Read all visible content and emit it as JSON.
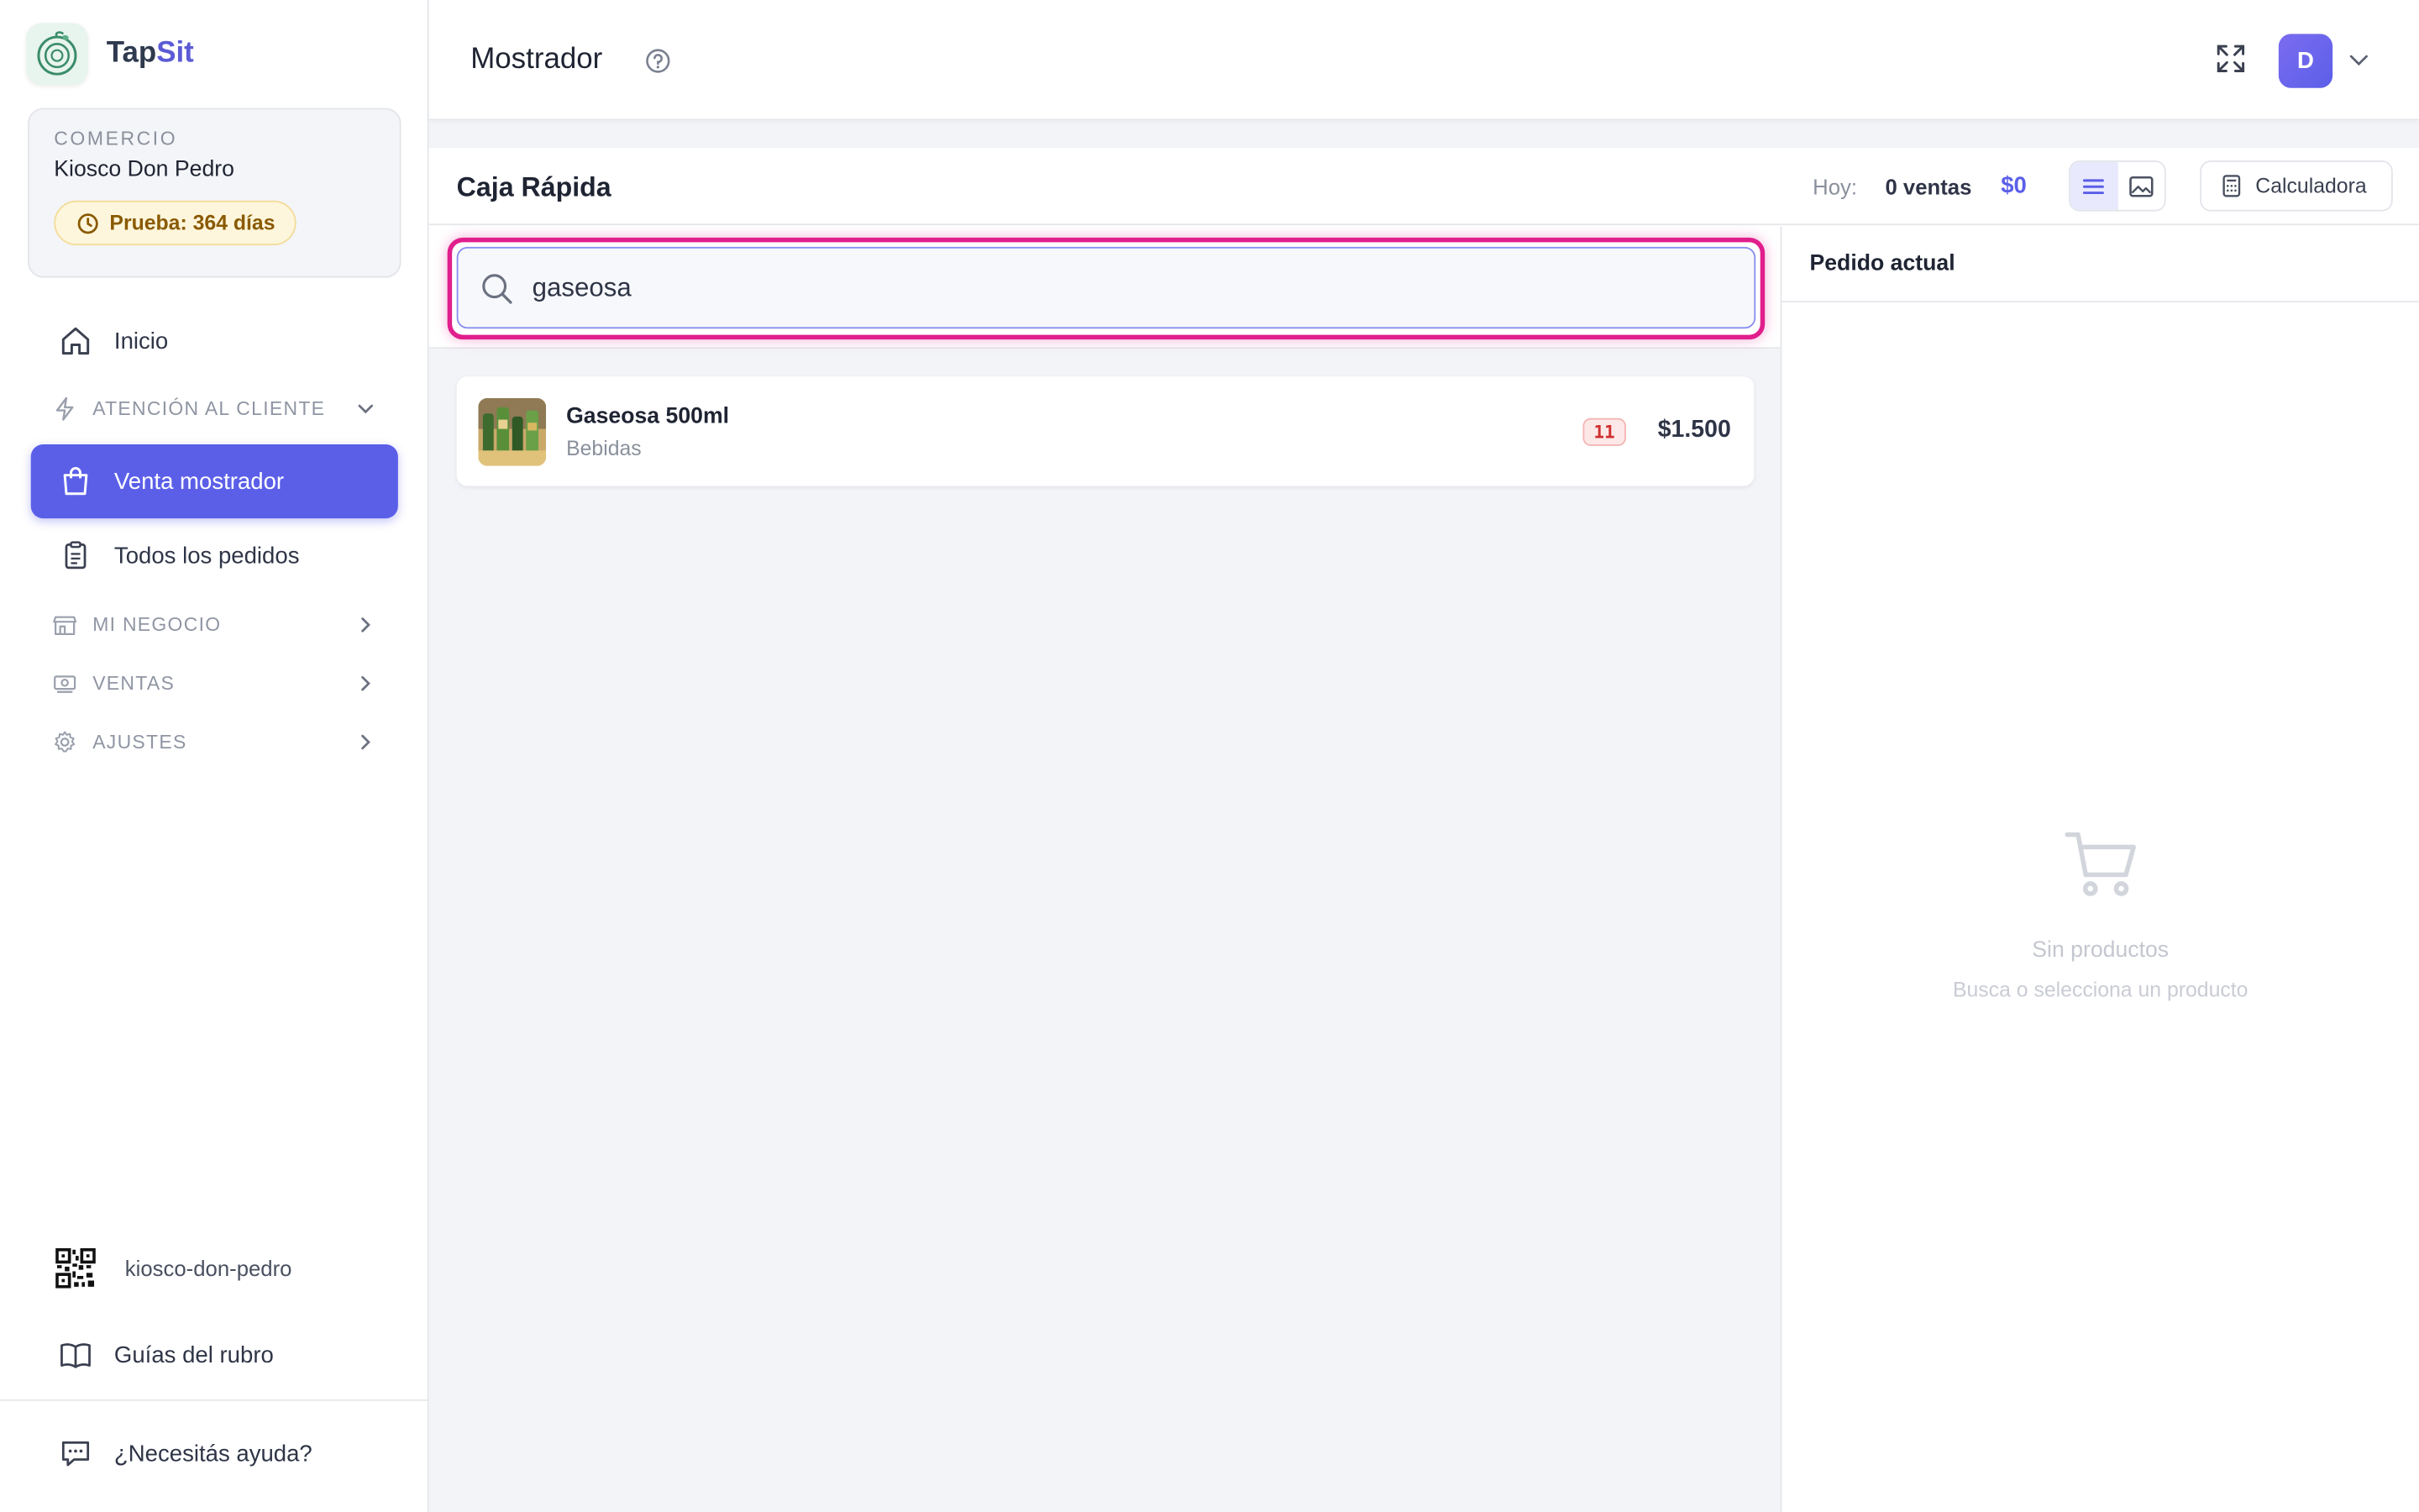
{
  "brand": {
    "name_part1": "Tap",
    "name_part2": "Sit"
  },
  "store": {
    "caption": "COMERCIO",
    "name": "Kiosco Don Pedro",
    "trial": "Prueba: 364 días"
  },
  "nav": {
    "inicio": "Inicio",
    "atencion": "ATENCIÓN AL CLIENTE",
    "venta_mostrador": "Venta mostrador",
    "todos_pedidos": "Todos los pedidos",
    "mi_negocio": "MI NEGOCIO",
    "ventas": "VENTAS",
    "ajustes": "AJUSTES"
  },
  "bottom": {
    "qr_slug": "kiosco-don-pedro",
    "guides": "Guías del rubro",
    "help": "¿Necesitás ayuda?"
  },
  "topbar": {
    "title": "Mostrador",
    "avatar_initial": "D"
  },
  "pos": {
    "title": "Caja Rápida",
    "today_label": "Hoy:",
    "today_count": "0 ventas",
    "today_total": "$0",
    "calculator": "Calculadora"
  },
  "search": {
    "value": "gaseosa"
  },
  "results": [
    {
      "name": "Gaseosa 500ml",
      "category": "Bebidas",
      "stock": "11",
      "price": "$1.500"
    }
  ],
  "order": {
    "title": "Pedido actual",
    "empty_title": "Sin productos",
    "empty_subtitle": "Busca o selecciona un producto"
  },
  "colors": {
    "accent": "#5b5fe8",
    "highlight": "#e01e8c",
    "trial_bg": "#fef6dc",
    "stock_red": "#d03030"
  }
}
